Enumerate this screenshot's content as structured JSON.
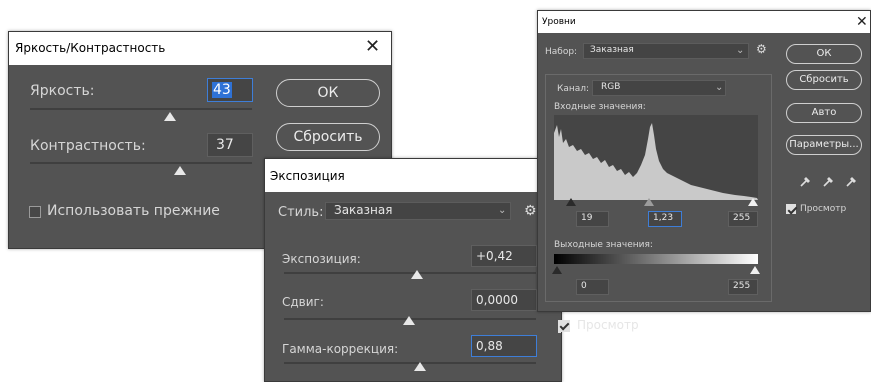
{
  "brightness_dialog": {
    "title": "Яркость/Контрастность",
    "brightness_label": "Яркость:",
    "brightness_value": "43",
    "contrast_label": "Контрастность:",
    "contrast_value": "37",
    "ok_label": "ОК",
    "reset_label": "Сбросить",
    "use_legacy_label": "Использовать прежние"
  },
  "exposure_dialog": {
    "title": "Экспозиция",
    "preset_label": "Стиль:",
    "preset_value": "Заказная",
    "exposure_label": "Экспозиция:",
    "exposure_value": "+0,42",
    "offset_label": "Сдвиг:",
    "offset_value": "0,0000",
    "gamma_label": "Гамма-коррекция:",
    "gamma_value": "0,88",
    "preview_label": "Просмотр"
  },
  "levels_dialog": {
    "title": "Уровни",
    "preset_label": "Набор:",
    "preset_value": "Заказная",
    "channel_label": "Канал:",
    "channel_value": "RGB",
    "input_levels_label": "Входные значения:",
    "input_black": "19",
    "input_gamma": "1,23",
    "input_white": "255",
    "output_levels_label": "Выходные значения:",
    "output_black": "0",
    "output_white": "255",
    "ok_label": "ОК",
    "reset_label": "Сбросить",
    "auto_label": "Авто",
    "options_label": "Параметры...",
    "preview_label": "Просмотр"
  },
  "icons": {
    "close": "close-icon",
    "gear": "gear-icon",
    "eyedropper": "eyedropper-icon",
    "chevron": "chevron-down-icon"
  },
  "colors": {
    "dialog_bg": "#535353",
    "titlebar_bg": "#ffffff",
    "focus_border": "#3e7ed8"
  }
}
